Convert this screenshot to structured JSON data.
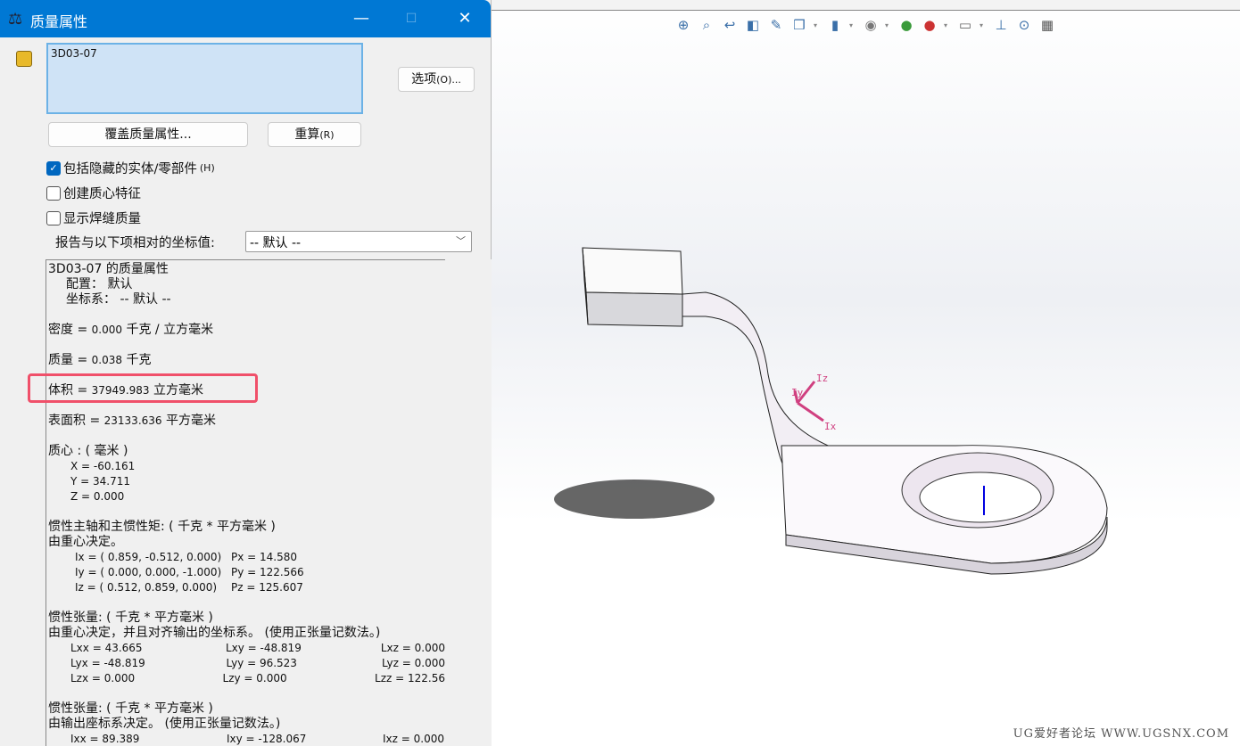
{
  "dialog": {
    "title": "质量属性",
    "minimize": "—",
    "maximize": "☐",
    "close": "✕",
    "selection": "3D03-07",
    "options_button": "选项",
    "options_key": "(O)...",
    "override_button": "覆盖质量属性...",
    "recalc_button": "重算",
    "recalc_key": "(R)",
    "checkboxes": [
      {
        "label": "包括隐藏的实体/零部件",
        "key": "(H)",
        "checked": true
      },
      {
        "label": "创建质心特征",
        "key": "",
        "checked": false
      },
      {
        "label": "显示焊缝质量",
        "key": "",
        "checked": false
      }
    ],
    "coord_label": "报告与以下项相对的坐标值:",
    "coord_value": "-- 默认 --"
  },
  "results": {
    "header": "3D03-07 的质量属性",
    "config": "配置：  默认",
    "coord": "坐标系：   -- 默认 --",
    "density": {
      "label": "密度 = ",
      "value": "0.000",
      "unit": " 千克 / 立方毫米"
    },
    "mass": {
      "label": "质量 = ",
      "value": "0.038",
      "unit": " 千克"
    },
    "volume": {
      "label": "体积 = ",
      "value": "37949.983",
      "unit": " 立方毫米"
    },
    "area": {
      "label": "表面积 = ",
      "value": "23133.636",
      "unit": "  平方毫米"
    },
    "com_title": "质心 : ( 毫米 )",
    "com": [
      "X = -60.161",
      "Y = 34.711",
      "Z = 0.000"
    ],
    "principal_title": "惯性主轴和主惯性矩: ( 千克 *  平方毫米 )",
    "principal_sub": "由重心决定。",
    "principal": [
      [
        "Ix = ( 0.859, -0.512,  0.000)",
        "Px = 14.580"
      ],
      [
        "Iy = ( 0.000,  0.000, -1.000)",
        "Py = 122.566"
      ],
      [
        "Iz = ( 0.512,  0.859,  0.000)",
        "Pz = 125.607"
      ]
    ],
    "tensor1_title": "惯性张量: ( 千克 *  平方毫米 )",
    "tensor1_sub": "由重心决定，并且对齐输出的坐标系。  (使用正张量记数法。)",
    "tensor1": [
      [
        "Lxx = 43.665",
        "Lxy = -48.819",
        "Lxz = 0.000"
      ],
      [
        "Lyx = -48.819",
        "Lyy = 96.523",
        "Lyz = 0.000"
      ],
      [
        "Lzx = 0.000",
        "Lzy = 0.000",
        "Lzz = 122.56"
      ]
    ],
    "tensor2_title": "惯性张量: ( 千克 *  平方毫米 )",
    "tensor2_sub": "由输出座标系决定。  (使用正张量记数法。)",
    "tensor2": [
      [
        "Ixx = 89.389",
        "Ixy = -128.067",
        "Ixz = 0.000"
      ]
    ]
  },
  "viewport": {
    "toolbar_icons": [
      "zoom-to-fit-icon",
      "zoom-to-area-icon",
      "previous-view-icon",
      "section-view-icon",
      "dynamic-annotation-icon",
      "view-orientation-icon",
      "display-style-icon",
      "hide-show-icon",
      "edit-appearance-icon",
      "apply-scene-icon",
      "view-settings-icon",
      "realview-icon",
      "measure-icon",
      "screen-capture-icon"
    ],
    "axis_labels": {
      "z": "Iz",
      "x": "Ix",
      "y": "Iy"
    },
    "watermark": "UG爱好者论坛 WWW.UGSNX.COM",
    "highlight_color": "#f0506a",
    "title_bar_color": "#0078d4"
  }
}
